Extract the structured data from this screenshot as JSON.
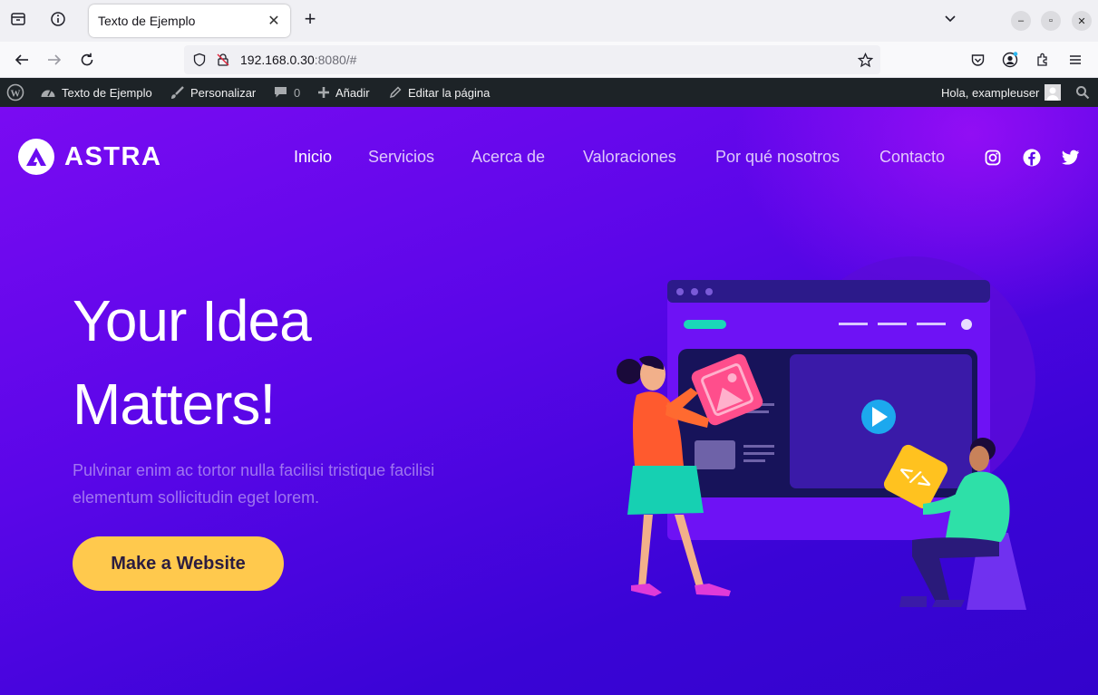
{
  "browser": {
    "tab_title": "Texto de Ejemplo",
    "url_host": "192.168.0.30",
    "url_rest": ":8080/#"
  },
  "admin_bar": {
    "site_name": "Texto de Ejemplo",
    "customize": "Personalizar",
    "comments_count": "0",
    "new": "Añadir",
    "edit_page": "Editar la página",
    "greeting": "Hola, exampleuser"
  },
  "site": {
    "logo_text": "ASTRA",
    "menu": [
      "Inicio",
      "Servicios",
      "Acerca de",
      "Valoraciones",
      "Por qué nosotros",
      "Contacto"
    ],
    "social_icons": [
      "instagram-icon",
      "facebook-icon",
      "twitter-icon"
    ],
    "hero": {
      "title_line1": "Your Idea",
      "title_line2": "Matters!",
      "subtitle": "Pulvinar enim ac tortor nulla facilisi tristique facilisi elementum sollicitudin eget lorem.",
      "cta_label": "Make a Website"
    }
  },
  "colors": {
    "hero_gradient_start": "#7a0bf2",
    "hero_gradient_end": "#3303cc",
    "cta": "#ffc94d",
    "admin_bar": "#1d2327"
  }
}
